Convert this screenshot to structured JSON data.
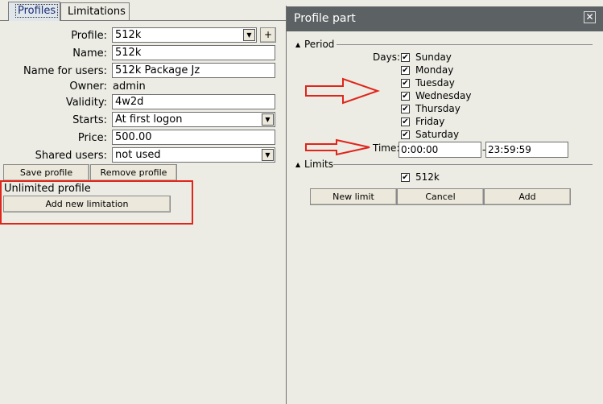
{
  "tabs": [
    {
      "label": "Profiles",
      "active": true
    },
    {
      "label": "Limitations",
      "active": false
    }
  ],
  "form": {
    "profile_label": "Profile:",
    "profile_value": "512k",
    "add_icon": "+",
    "name_label": "Name:",
    "name_value": "512k",
    "name_for_users_label": "Name for users:",
    "name_for_users_value": "512k Package Jz",
    "owner_label": "Owner:",
    "owner_value": "admin",
    "validity_label": "Validity:",
    "validity_value": "4w2d",
    "starts_label": "Starts:",
    "starts_value": "At first logon",
    "price_label": "Price:",
    "price_value": "500.00",
    "shared_users_label": "Shared users:",
    "shared_users_value": "not used"
  },
  "buttons": {
    "save_profile": "Save profile",
    "remove_profile": "Remove profile",
    "add_new_limitation": "Add new limitation"
  },
  "unlimited_profile_text": "Unlimited profile",
  "dialog": {
    "title": "Profile part",
    "close_glyph": "✕",
    "period_label": "Period",
    "days_label": "Days:",
    "days": [
      {
        "name": "Sunday",
        "checked": true
      },
      {
        "name": "Monday",
        "checked": true
      },
      {
        "name": "Tuesday",
        "checked": true
      },
      {
        "name": "Wednesday",
        "checked": true
      },
      {
        "name": "Thursday",
        "checked": true
      },
      {
        "name": "Friday",
        "checked": true
      },
      {
        "name": "Saturday",
        "checked": true
      }
    ],
    "time_label": "Time:",
    "time_from": "0:00:00",
    "time_separator": "-",
    "time_to": "23:59:59",
    "limits_label": "Limits",
    "limits": [
      {
        "name": "512k",
        "checked": true
      }
    ],
    "new_limit": "New limit",
    "cancel": "Cancel",
    "add": "Add"
  },
  "colors": {
    "annotation_red": "#e0251b",
    "titlebar": "#5c6264",
    "background": "#ecece4"
  },
  "icons": {
    "check": "✔",
    "dropdown": "▼",
    "collapse": "▲"
  }
}
